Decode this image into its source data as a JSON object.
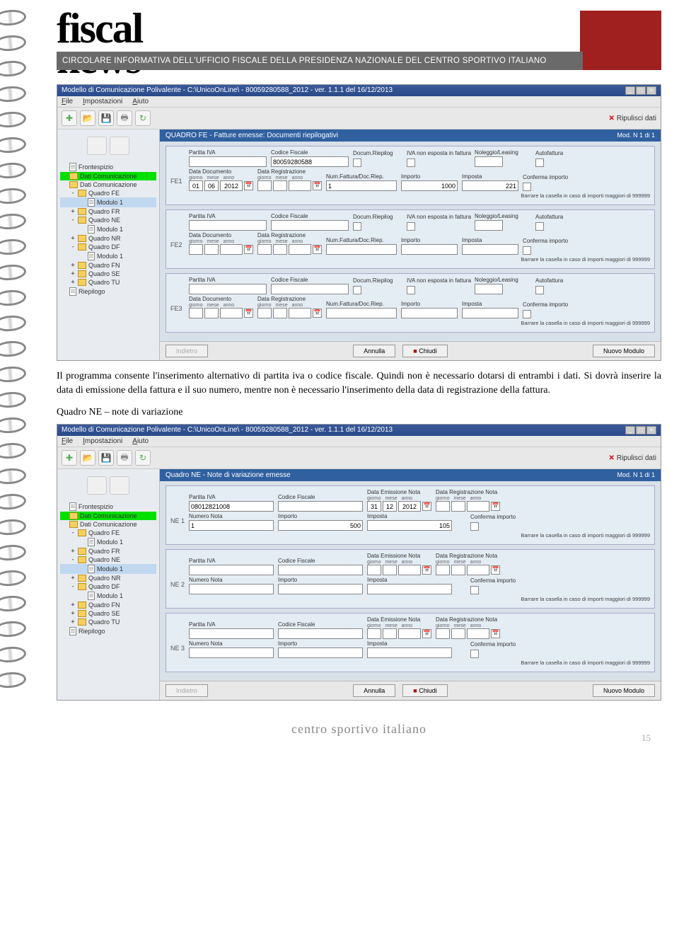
{
  "masthead": {
    "title": "fiscal",
    "subtitle": "news",
    "bar": "CIRCOLARE INFORMATIVA DELL'UFFICIO FISCALE DELLA PRESIDENZA NAZIONALE DEL CENTRO SPORTIVO ITALIANO"
  },
  "app1": {
    "title": "Modello di Comunicazione Polivalente - C:\\UnicoOnLine\\ - 80059280588_2012 - ver. 1.1.1 del 16/12/2013",
    "menu": [
      "File",
      "Impostazioni",
      "Aiuto"
    ],
    "ripulisci": "Ripulisci dati",
    "tree": [
      {
        "lvl": 1,
        "ic": "doc",
        "label": "Frontespizio",
        "sel": false
      },
      {
        "lvl": 1,
        "ic": "folder",
        "label": "Dati Comunicazione",
        "sel": true
      },
      {
        "lvl": 1,
        "ic": "folder",
        "label": "Dati Comunicazione",
        "sel": false
      },
      {
        "lvl": 2,
        "ic": "folder",
        "label": "Quadro FE",
        "sel": false,
        "exp": "-"
      },
      {
        "lvl": 3,
        "ic": "doc",
        "label": "Modulo 1",
        "sel": false,
        "hl": true
      },
      {
        "lvl": 2,
        "ic": "folder",
        "label": "Quadro FR",
        "sel": false,
        "exp": "+"
      },
      {
        "lvl": 2,
        "ic": "folder",
        "label": "Quadro NE",
        "sel": false,
        "exp": "-"
      },
      {
        "lvl": 3,
        "ic": "doc",
        "label": "Modulo 1",
        "sel": false
      },
      {
        "lvl": 2,
        "ic": "folder",
        "label": "Quadro NR",
        "sel": false,
        "exp": "+"
      },
      {
        "lvl": 2,
        "ic": "folder",
        "label": "Quadro DF",
        "sel": false,
        "exp": "-"
      },
      {
        "lvl": 3,
        "ic": "doc",
        "label": "Modulo 1",
        "sel": false
      },
      {
        "lvl": 2,
        "ic": "folder",
        "label": "Quadro FN",
        "sel": false,
        "exp": "+"
      },
      {
        "lvl": 2,
        "ic": "folder",
        "label": "Quadro SE",
        "sel": false,
        "exp": "+"
      },
      {
        "lvl": 2,
        "ic": "folder",
        "label": "Quadro TU",
        "sel": false,
        "exp": "+"
      },
      {
        "lvl": 1,
        "ic": "doc",
        "label": "Riepilogo",
        "sel": false
      }
    ],
    "header": "QUADRO FE - Fatture emesse: Documenti riepilogativi",
    "modnav": "Mod. N 1 di 1",
    "labels": {
      "piva": "Partita IVA",
      "cf": "Codice Fiscale",
      "docriep": "Docum.Riepilog",
      "ivanon": "IVA non esposta in fattura",
      "noleggio": "Noleggio/Leasing",
      "autofatt": "Autofattura",
      "datadoc": "Data Documento",
      "datareg": "Data Registrazione",
      "numfatt": "Num.Fattura/Doc.Riep.",
      "importo": "Importo",
      "imposta": "Imposta",
      "conferma": "Conferma importo",
      "hint": "Barrare la casella in caso di importi maggiori di 999999",
      "gma": [
        "giorno",
        "mese",
        "anno"
      ]
    },
    "entries": [
      {
        "id": "FE1",
        "cf": "80059280588",
        "dd": [
          "01",
          "06",
          "2012"
        ],
        "num": "1",
        "importo": "1000",
        "imposta": "221"
      },
      {
        "id": "FE2",
        "cf": "",
        "dd": [
          "",
          "",
          ""
        ],
        "num": "",
        "importo": "",
        "imposta": ""
      },
      {
        "id": "FE3",
        "cf": "",
        "dd": [
          "",
          "",
          ""
        ],
        "num": "",
        "importo": "",
        "imposta": ""
      }
    ],
    "buttons": {
      "indietro": "Indietro",
      "annulla": "Annulla",
      "chiudi": "Chiudi",
      "nuovo": "Nuovo Modulo"
    }
  },
  "para1": "Il programma consente l'inserimento alternativo di partita iva o codice fiscale. Quindi non è necessario dotarsi di  entrambi i dati.  Si dovrà inserire la data di emissione della fattura e il suo numero, mentre non è necessario l'inserimento della data di registrazione della fattura.",
  "section2_title": "Quadro NE – note di variazione",
  "app2": {
    "title": "Modello di Comunicazione Polivalente - C:\\UnicoOnLine\\ - 80059280588_2012 - ver. 1.1.1 del 16/12/2013",
    "menu": [
      "File",
      "Impostazioni",
      "Aiuto"
    ],
    "ripulisci": "Ripulisci dati",
    "tree": [
      {
        "lvl": 1,
        "ic": "doc",
        "label": "Frontespizio",
        "sel": false
      },
      {
        "lvl": 1,
        "ic": "folder",
        "label": "Dati Comunicazione",
        "sel": true
      },
      {
        "lvl": 1,
        "ic": "folder",
        "label": "Dati Comunicazione",
        "sel": false
      },
      {
        "lvl": 2,
        "ic": "folder",
        "label": "Quadro FE",
        "sel": false,
        "exp": "-"
      },
      {
        "lvl": 3,
        "ic": "doc",
        "label": "Modulo 1",
        "sel": false
      },
      {
        "lvl": 2,
        "ic": "folder",
        "label": "Quadro FR",
        "sel": false,
        "exp": "+"
      },
      {
        "lvl": 2,
        "ic": "folder",
        "label": "Quadro NE",
        "sel": false,
        "exp": "-"
      },
      {
        "lvl": 3,
        "ic": "doc",
        "label": "Modulo 1",
        "sel": false,
        "hl": true
      },
      {
        "lvl": 2,
        "ic": "folder",
        "label": "Quadro NR",
        "sel": false,
        "exp": "+"
      },
      {
        "lvl": 2,
        "ic": "folder",
        "label": "Quadro DF",
        "sel": false,
        "exp": "-"
      },
      {
        "lvl": 3,
        "ic": "doc",
        "label": "Modulo 1",
        "sel": false
      },
      {
        "lvl": 2,
        "ic": "folder",
        "label": "Quadro FN",
        "sel": false,
        "exp": "+"
      },
      {
        "lvl": 2,
        "ic": "folder",
        "label": "Quadro SE",
        "sel": false,
        "exp": "+"
      },
      {
        "lvl": 2,
        "ic": "folder",
        "label": "Quadro TU",
        "sel": false,
        "exp": "+"
      },
      {
        "lvl": 1,
        "ic": "doc",
        "label": "Riepilogo",
        "sel": false
      }
    ],
    "header": "Quadro NE - Note di variazione emesse",
    "modnav": "Mod. N 1 di 1",
    "labels": {
      "piva": "Partita IVA",
      "cf": "Codice Fiscale",
      "dataem": "Data Emissione Nota",
      "datareg": "Data Registrazione Nota",
      "numnota": "Numero Nota",
      "importo": "Importo",
      "imposta": "Imposta",
      "conferma": "Conferma importo",
      "hint": "Barrare la casella in caso di importi maggiori di 999999",
      "gma": [
        "giorno",
        "mese",
        "anno"
      ]
    },
    "entries": [
      {
        "id": "NE 1",
        "piva": "08012821008",
        "de": [
          "31",
          "12",
          "2012"
        ],
        "num": "1",
        "importo": "500",
        "imposta": "105"
      },
      {
        "id": "NE 2",
        "piva": "",
        "de": [
          "",
          "",
          ""
        ],
        "num": "",
        "importo": "",
        "imposta": ""
      },
      {
        "id": "NE 3",
        "piva": "",
        "de": [
          "",
          "",
          ""
        ],
        "num": "",
        "importo": "",
        "imposta": ""
      }
    ],
    "buttons": {
      "indietro": "Indietro",
      "annulla": "Annulla",
      "chiudi": "Chiudi",
      "nuovo": "Nuovo Modulo"
    }
  },
  "footer": "centro sportivo italiano",
  "pagenum": "15"
}
